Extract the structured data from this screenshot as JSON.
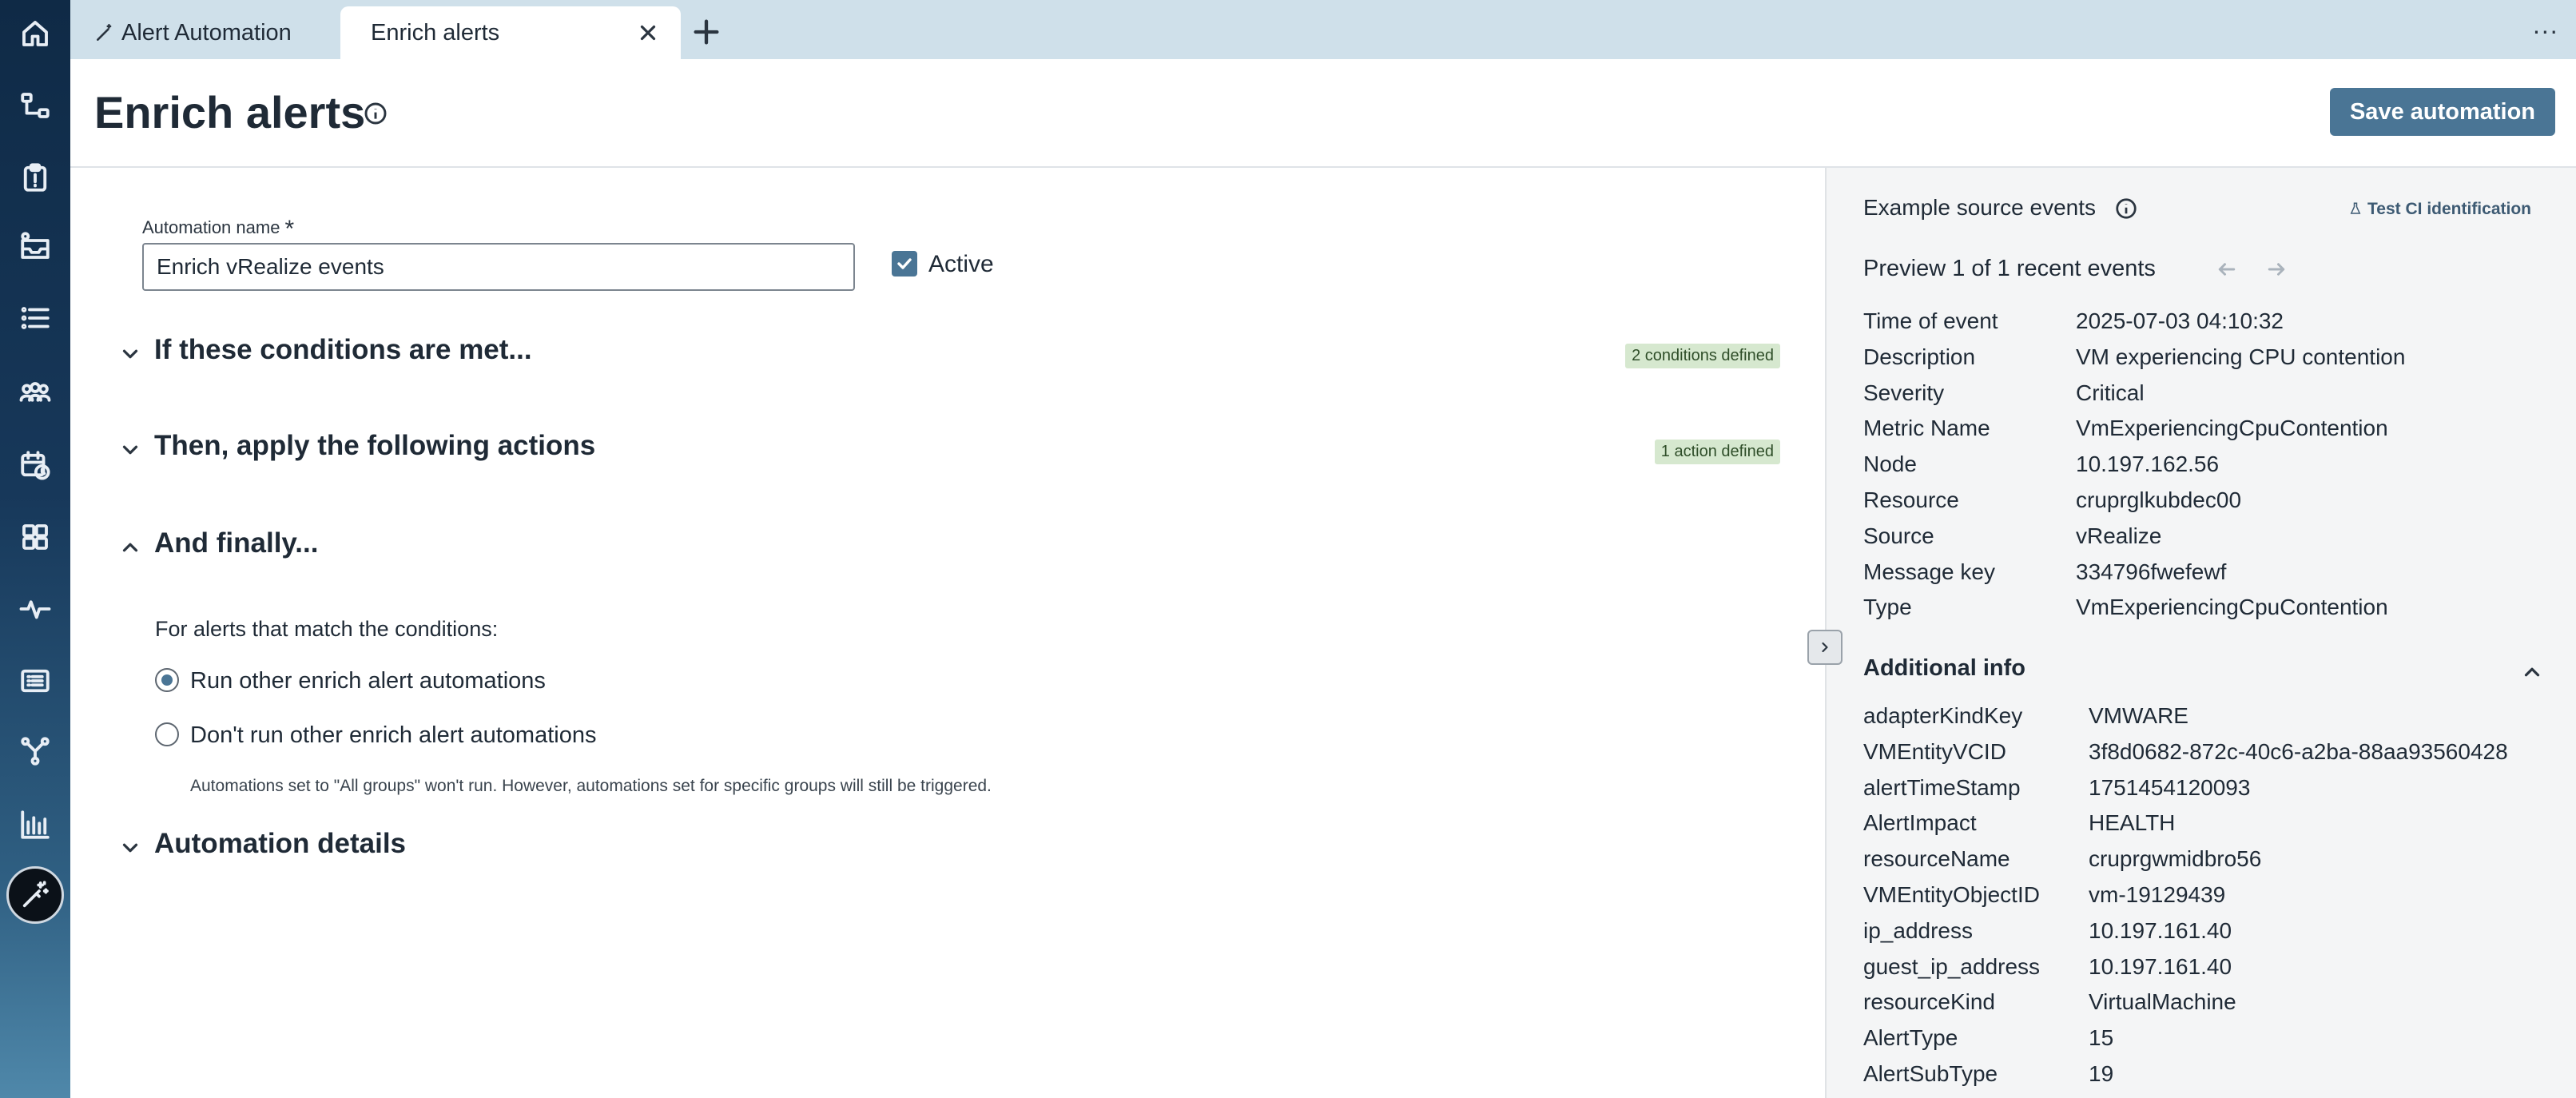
{
  "tabs": {
    "items": [
      {
        "label": "Alert Automation",
        "icon": "wand-icon"
      },
      {
        "label": "Enrich alerts"
      }
    ],
    "more_label": "..."
  },
  "header": {
    "title": "Enrich alerts",
    "save_label": "Save automation"
  },
  "form": {
    "name_label": "Automation name",
    "required_mark": "*",
    "name_value": "Enrich vRealize events",
    "active_label": "Active",
    "active_checked": true
  },
  "sections": {
    "conditions": {
      "title": "If these conditions are met...",
      "badge": "2 conditions defined",
      "expanded": false
    },
    "actions": {
      "title": "Then, apply the following actions",
      "badge": "1 action defined",
      "expanded": false
    },
    "finally": {
      "title": "And finally...",
      "expanded": true,
      "prompt": "For alerts that match the conditions:",
      "options": [
        "Run other enrich alert automations",
        "Don't run other enrich alert automations"
      ],
      "selected_index": 0,
      "help": "Automations set to \"All groups\" won't run. However, automations set for specific groups will still be triggered."
    },
    "details": {
      "title": "Automation details",
      "expanded": false
    }
  },
  "panel": {
    "title": "Example source events",
    "test_ci_label": "Test CI identification",
    "preview_label": "Preview 1 of 1 recent events",
    "fields": [
      {
        "key": "Time of event",
        "value": "2025-07-03 04:10:32"
      },
      {
        "key": "Description",
        "value": "VM experiencing CPU contention"
      },
      {
        "key": "Severity",
        "value": "Critical"
      },
      {
        "key": "Metric Name",
        "value": "VmExperiencingCpuContention"
      },
      {
        "key": "Node",
        "value": "10.197.162.56"
      },
      {
        "key": "Resource",
        "value": "cruprglkubdec00"
      },
      {
        "key": "Source",
        "value": "vRealize"
      },
      {
        "key": "Message key",
        "value": "334796fwefewf"
      },
      {
        "key": "Type",
        "value": "VmExperiencingCpuContention"
      }
    ],
    "additional_title": "Additional info",
    "additional": [
      {
        "key": "adapterKindKey",
        "value": "VMWARE"
      },
      {
        "key": "VMEntityVCID",
        "value": "3f8d0682-872c-40c6-a2ba-88aa93560428"
      },
      {
        "key": "alertTimeStamp",
        "value": "1751454120093"
      },
      {
        "key": "AlertImpact",
        "value": "HEALTH"
      },
      {
        "key": "resourceName",
        "value": "cruprgwmidbro56"
      },
      {
        "key": "VMEntityObjectID",
        "value": "vm-19129439"
      },
      {
        "key": "ip_address",
        "value": "10.197.161.40"
      },
      {
        "key": "guest_ip_address",
        "value": "10.197.161.40"
      },
      {
        "key": "resourceKind",
        "value": "VirtualMachine"
      },
      {
        "key": "AlertType",
        "value": "15"
      },
      {
        "key": "AlertSubType",
        "value": "19"
      }
    ]
  },
  "colors": {
    "accent": "#4a7595",
    "badge_bg": "#d6e8cf",
    "tabbar_bg": "#cfe0ea",
    "panel_bg": "#f4f5f6"
  }
}
